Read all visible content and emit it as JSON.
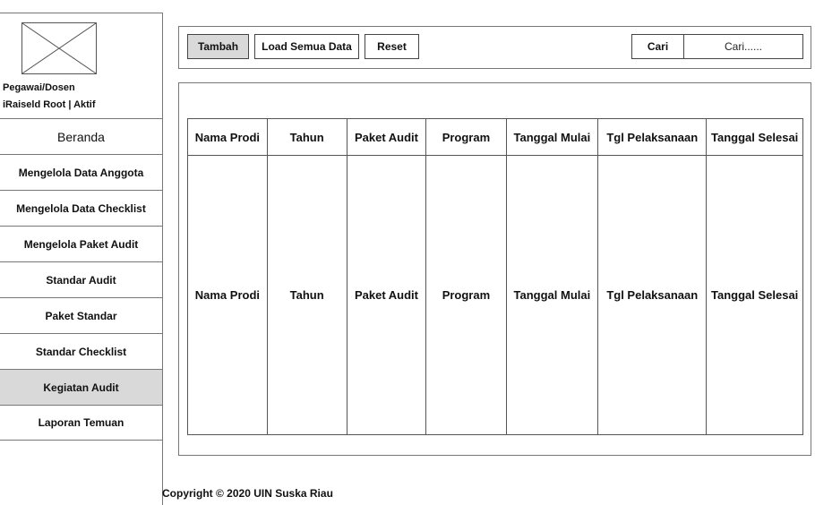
{
  "sidebar": {
    "logo_icon": "image-placeholder-icon",
    "user_role": "Pegawai/Dosen",
    "user_status": "iRaiseld Root  |  Aktif",
    "items": [
      {
        "label": "Beranda"
      },
      {
        "label": "Mengelola Data Anggota"
      },
      {
        "label": "Mengelola Data Checklist"
      },
      {
        "label": "Mengelola Paket Audit"
      },
      {
        "label": "Standar Audit"
      },
      {
        "label": "Paket Standar"
      },
      {
        "label": "Standar Checklist"
      },
      {
        "label": "Kegiatan Audit",
        "active": true
      },
      {
        "label": "Laporan Temuan"
      }
    ]
  },
  "toolbar": {
    "add_label": "Tambah",
    "load_label": "Load Semua Data",
    "reset_label": "Reset",
    "search_label": "Cari",
    "search_value": "Cari......"
  },
  "table": {
    "headers": [
      "Nama Prodi",
      "Tahun",
      "Paket Audit",
      "Program",
      "Tanggal Mulai",
      "Tgl Pelaksanaan",
      "Tanggal Selesai"
    ],
    "rows": [
      [
        "Nama Prodi",
        "Tahun",
        "Paket Audit",
        "Program",
        "Tanggal Mulai",
        "Tgl Pelaksanaan",
        "Tanggal Selesai"
      ]
    ]
  },
  "footer": {
    "copyright": "Copyright © 2020 UIN Suska Riau"
  },
  "colors": {
    "active_bg": "#d9d9d9",
    "border": "#777777"
  }
}
